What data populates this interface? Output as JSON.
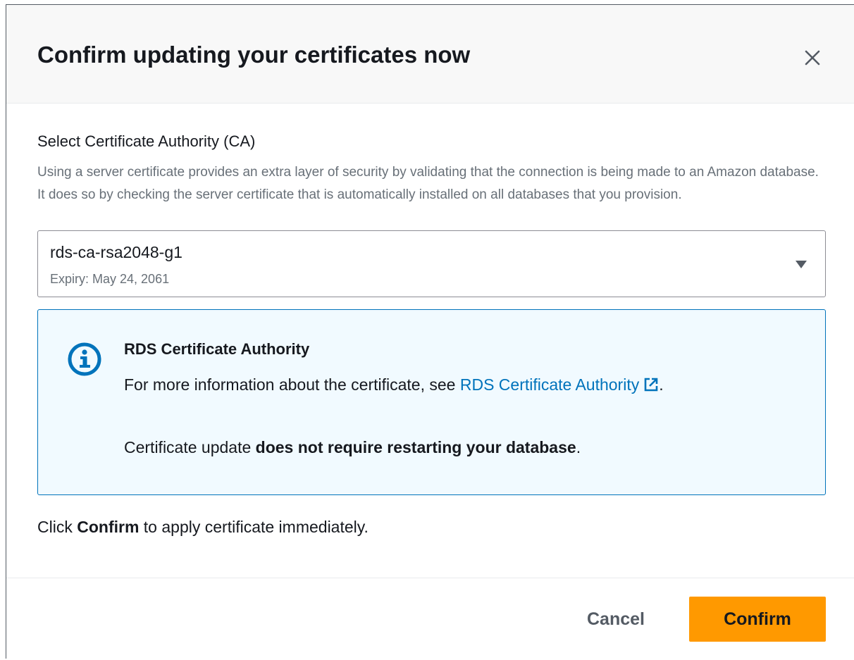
{
  "modal": {
    "title": "Confirm updating your certificates now",
    "close_icon": "close-icon"
  },
  "ca_field": {
    "label": "Select Certificate Authority (CA)",
    "description": "Using a server certificate provides an extra layer of security by validating that the connection is being made to an Amazon database. It does so by checking the server certificate that is automatically installed on all databases that you provision.",
    "selected_value": "rds-ca-rsa2048-g1",
    "selected_expiry": "Expiry: May 24, 2061",
    "caret_icon": "caret-down-icon"
  },
  "info_alert": {
    "icon": "info-icon",
    "title": "RDS Certificate Authority",
    "text_before_link": "For more information about the certificate, see ",
    "link_text": "RDS Certificate Authority",
    "link_icon": "external-link-icon",
    "text_after_link": ".",
    "note_prefix": "Certificate update ",
    "note_bold": "does not require restarting your database",
    "note_suffix": ".",
    "accent_color": "#0073bb",
    "background_color": "#f1faff"
  },
  "instruction": {
    "prefix": "Click ",
    "bold": "Confirm",
    "suffix": " to apply certificate immediately."
  },
  "footer": {
    "cancel_label": "Cancel",
    "confirm_label": "Confirm",
    "confirm_color": "#ff9900"
  }
}
